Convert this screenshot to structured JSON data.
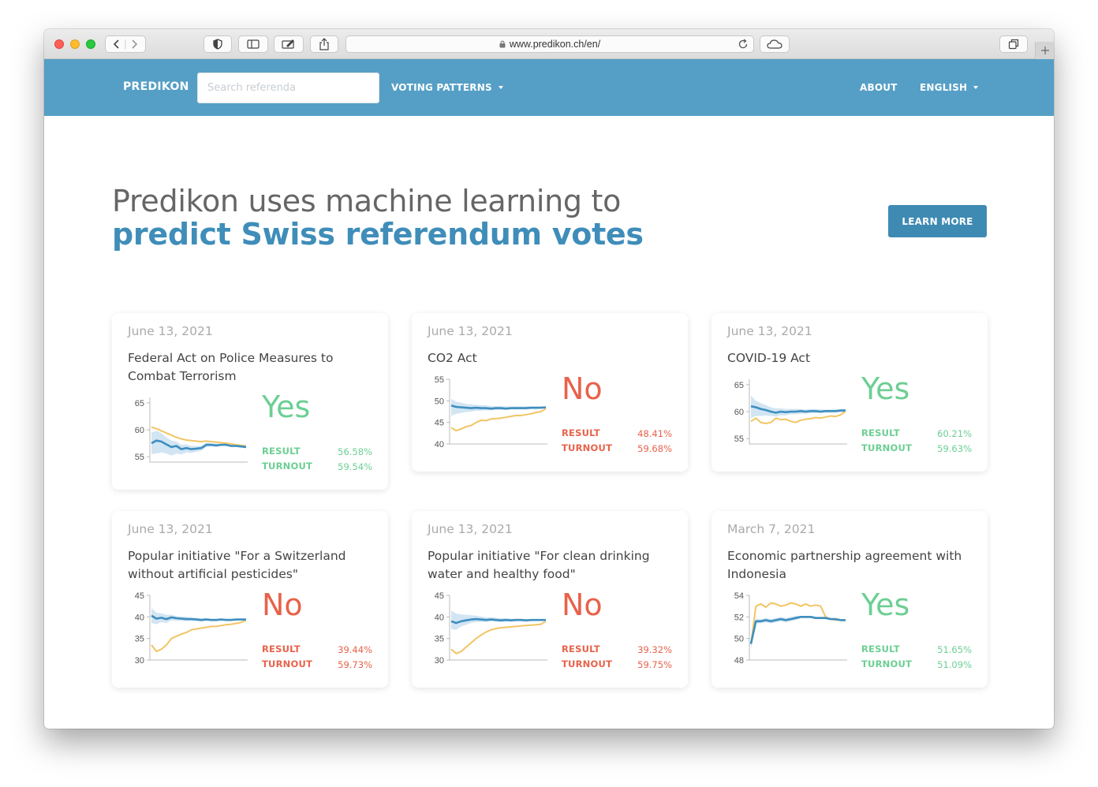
{
  "browser": {
    "url": "www.predikon.ch/en/"
  },
  "nav": {
    "brand": "PREDIKON",
    "search_placeholder": "Search referenda",
    "voting_patterns": "VOTING PATTERNS",
    "about": "ABOUT",
    "language": "ENGLISH"
  },
  "hero": {
    "line1": "Predikon uses machine learning to",
    "line2": "predict Swiss referendum votes",
    "cta": "LEARN MORE"
  },
  "colors": {
    "navbar": "#559fc6",
    "accent": "#3f8db9",
    "yes": "#6ccf93",
    "no": "#e8624a",
    "prediction_line": "#3d8ebf",
    "prediction_band": "#c7dff0",
    "result_line": "#f2c464"
  },
  "labels": {
    "result": "RESULT",
    "turnout": "TURNOUT"
  },
  "cards": [
    {
      "date": "June 13, 2021",
      "title": "Federal Act on Police Measures to Combat Terrorism",
      "verdict": "Yes",
      "outcome": "yes",
      "result": "56.58%",
      "turnout": "59.54%",
      "chart_data": {
        "type": "line",
        "ylim": [
          54,
          66
        ],
        "yticks": [
          55,
          60,
          65
        ],
        "series": [
          {
            "values": [
              57.5,
              58,
              57.8,
              57.3,
              56.8,
              57,
              56.4,
              56.6,
              56.4,
              56.5,
              56.6,
              57.2,
              57.2,
              57.1,
              57.2,
              57.2,
              57.0,
              57.0,
              56.9,
              56.8
            ]
          },
          {
            "values": [
              60.5,
              60.2,
              59.8,
              59.4,
              59.0,
              58.6,
              58.3,
              58.1,
              58.0,
              57.9,
              57.8,
              57.9,
              57.8,
              57.7,
              57.6,
              57.5,
              57.4,
              57.2,
              57.1,
              57.0
            ]
          }
        ],
        "band": {
          "upper": [
            59.5,
            59.8,
            59.4,
            58.6,
            58.0,
            57.8,
            57.2,
            57.3,
            57.0,
            57.0,
            57.0,
            57.6,
            57.5,
            57.4,
            57.4,
            57.4,
            57.2,
            57.2,
            57.1,
            57.0
          ],
          "lower": [
            55.5,
            55.6,
            55.8,
            55.6,
            55.2,
            55.6,
            55.4,
            55.8,
            55.7,
            55.9,
            56.1,
            56.8,
            56.9,
            56.8,
            57.0,
            57.0,
            56.8,
            56.8,
            56.7,
            56.6
          ]
        }
      }
    },
    {
      "date": "June 13, 2021",
      "title": "CO2 Act",
      "verdict": "No",
      "outcome": "no",
      "result": "48.41%",
      "turnout": "59.68%",
      "chart_data": {
        "type": "line",
        "ylim": [
          40,
          55
        ],
        "yticks": [
          40,
          45,
          50,
          55
        ],
        "series": [
          {
            "values": [
              48.9,
              48.6,
              48.5,
              48.4,
              48.3,
              48.4,
              48.3,
              48.3,
              48.2,
              48.3,
              48.3,
              48.2,
              48.3,
              48.3,
              48.3,
              48.3,
              48.4,
              48.4,
              48.4,
              48.5
            ]
          },
          {
            "values": [
              43.8,
              43.1,
              43.5,
              44.0,
              44.3,
              45.0,
              45.5,
              45.4,
              45.8,
              45.9,
              46.0,
              46.2,
              46.4,
              46.6,
              46.6,
              46.8,
              47.0,
              47.3,
              47.5,
              48.2
            ]
          }
        ],
        "band": {
          "upper": [
            50.5,
            49.8,
            49.6,
            49.3,
            49.2,
            49.1,
            49.0,
            48.9,
            48.8,
            48.8,
            48.8,
            48.7,
            48.7,
            48.7,
            48.7,
            48.7,
            48.7,
            48.7,
            48.7,
            48.7
          ],
          "lower": [
            46.5,
            47.0,
            47.2,
            47.4,
            47.5,
            47.7,
            47.7,
            47.8,
            47.8,
            47.9,
            47.9,
            47.9,
            48.0,
            48.0,
            48.0,
            48.0,
            48.1,
            48.1,
            48.2,
            48.3
          ]
        }
      }
    },
    {
      "date": "June 13, 2021",
      "title": "COVID-19 Act",
      "verdict": "Yes",
      "outcome": "yes",
      "result": "60.21%",
      "turnout": "59.63%",
      "chart_data": {
        "type": "line",
        "ylim": [
          54,
          66
        ],
        "yticks": [
          55,
          60,
          65
        ],
        "series": [
          {
            "values": [
              61.0,
              60.8,
              60.5,
              60.3,
              60.0,
              59.8,
              60.0,
              59.9,
              60.0,
              60.0,
              60.1,
              60.0,
              60.1,
              60.1,
              60.0,
              60.1,
              60.1,
              60.1,
              60.2,
              60.2
            ]
          },
          {
            "values": [
              58.2,
              58.8,
              58.0,
              57.8,
              58.0,
              58.8,
              58.5,
              58.6,
              58.2,
              58.0,
              58.4,
              58.6,
              58.7,
              58.9,
              58.8,
              59.0,
              59.2,
              59.1,
              59.4,
              60.1
            ]
          }
        ],
        "band": {
          "upper": [
            63.0,
            62.0,
            61.6,
            61.2,
            60.8,
            60.6,
            60.6,
            60.5,
            60.5,
            60.5,
            60.5,
            60.4,
            60.5,
            60.5,
            60.4,
            60.4,
            60.4,
            60.4,
            60.5,
            60.5
          ],
          "lower": [
            58.8,
            59.2,
            59.2,
            59.3,
            59.2,
            59.1,
            59.3,
            59.3,
            59.5,
            59.5,
            59.6,
            59.6,
            59.7,
            59.7,
            59.7,
            59.8,
            59.8,
            59.8,
            59.9,
            59.9
          ]
        }
      }
    },
    {
      "date": "June 13, 2021",
      "title": "Popular initiative \"For a Switzerland without artificial pesticides\"",
      "verdict": "No",
      "outcome": "no",
      "result": "39.44%",
      "turnout": "59.73%",
      "chart_data": {
        "type": "line",
        "ylim": [
          30,
          45
        ],
        "yticks": [
          30,
          35,
          40,
          45
        ],
        "series": [
          {
            "values": [
              40.3,
              39.6,
              39.8,
              39.5,
              39.9,
              39.7,
              39.6,
              39.5,
              39.5,
              39.4,
              39.3,
              39.4,
              39.3,
              39.3,
              39.4,
              39.3,
              39.3,
              39.4,
              39.4,
              39.4
            ]
          },
          {
            "values": [
              33.5,
              32.0,
              32.5,
              33.5,
              35.0,
              35.5,
              36.0,
              36.4,
              37.0,
              37.2,
              37.4,
              37.6,
              37.8,
              37.8,
              38.0,
              38.2,
              38.3,
              38.5,
              38.7,
              39.3
            ]
          }
        ],
        "band": {
          "upper": [
            42.0,
            41.0,
            40.8,
            40.5,
            40.5,
            40.2,
            40.1,
            40.0,
            39.9,
            39.8,
            39.7,
            39.7,
            39.6,
            39.6,
            39.6,
            39.6,
            39.6,
            39.6,
            39.6,
            39.6
          ],
          "lower": [
            38.6,
            38.3,
            38.8,
            38.6,
            39.2,
            39.1,
            39.1,
            39.0,
            39.1,
            39.0,
            38.9,
            39.1,
            39.0,
            39.0,
            39.2,
            39.1,
            39.1,
            39.2,
            39.2,
            39.2
          ]
        }
      }
    },
    {
      "date": "June 13, 2021",
      "title": "Popular initiative \"For clean drinking water and healthy food\"",
      "verdict": "No",
      "outcome": "no",
      "result": "39.32%",
      "turnout": "59.75%",
      "chart_data": {
        "type": "line",
        "ylim": [
          30,
          45
        ],
        "yticks": [
          30,
          35,
          40,
          45
        ],
        "series": [
          {
            "values": [
              39.0,
              38.6,
              39.0,
              39.2,
              39.4,
              39.5,
              39.4,
              39.3,
              39.4,
              39.3,
              39.2,
              39.3,
              39.2,
              39.3,
              39.3,
              39.2,
              39.3,
              39.3,
              39.3,
              39.3
            ]
          },
          {
            "values": [
              32.5,
              31.5,
              32.0,
              33.0,
              34.0,
              35.0,
              35.8,
              36.5,
              37.0,
              37.3,
              37.5,
              37.6,
              37.7,
              37.8,
              37.9,
              38.0,
              38.1,
              38.2,
              38.3,
              39.0
            ]
          }
        ],
        "band": {
          "upper": [
            41.5,
            40.8,
            40.6,
            40.5,
            40.4,
            40.3,
            40.1,
            39.9,
            39.9,
            39.8,
            39.7,
            39.7,
            39.6,
            39.6,
            39.6,
            39.5,
            39.5,
            39.5,
            39.5,
            39.5
          ],
          "lower": [
            37.2,
            37.0,
            37.8,
            38.2,
            38.6,
            38.8,
            38.8,
            38.8,
            39.0,
            38.9,
            38.8,
            38.9,
            38.9,
            39.0,
            39.0,
            38.9,
            39.0,
            39.1,
            39.1,
            39.1
          ]
        }
      }
    },
    {
      "date": "March 7, 2021",
      "title": "Economic partnership agreement with Indonesia",
      "verdict": "Yes",
      "outcome": "yes",
      "result": "51.65%",
      "turnout": "51.09%",
      "chart_data": {
        "type": "line",
        "ylim": [
          48,
          54
        ],
        "yticks": [
          48,
          50,
          52,
          54
        ],
        "series": [
          {
            "values": [
              49.5,
              51.6,
              51.6,
              51.7,
              51.6,
              51.7,
              51.8,
              51.7,
              51.8,
              51.9,
              52.0,
              52.0,
              52.0,
              51.9,
              51.9,
              51.9,
              51.8,
              51.8,
              51.7,
              51.7
            ]
          },
          {
            "values": [
              49.5,
              53.0,
              53.2,
              52.9,
              53.3,
              53.2,
              53.0,
              53.1,
              53.3,
              53.2,
              53.0,
              53.2,
              53.0,
              53.1,
              53.0,
              52.0,
              51.8,
              51.7,
              51.7,
              51.7
            ]
          }
        ],
        "band": {
          "upper": [
            50.0,
            51.8,
            51.8,
            51.9,
            51.8,
            51.9,
            52.0,
            51.9,
            52.0,
            52.1,
            52.1,
            52.1,
            52.1,
            52.0,
            52.0,
            52.0,
            51.9,
            51.9,
            51.8,
            51.8
          ],
          "lower": [
            49.0,
            51.4,
            51.4,
            51.5,
            51.4,
            51.5,
            51.6,
            51.5,
            51.6,
            51.7,
            51.9,
            51.9,
            51.9,
            51.8,
            51.8,
            51.8,
            51.7,
            51.7,
            51.6,
            51.6
          ]
        }
      }
    }
  ]
}
